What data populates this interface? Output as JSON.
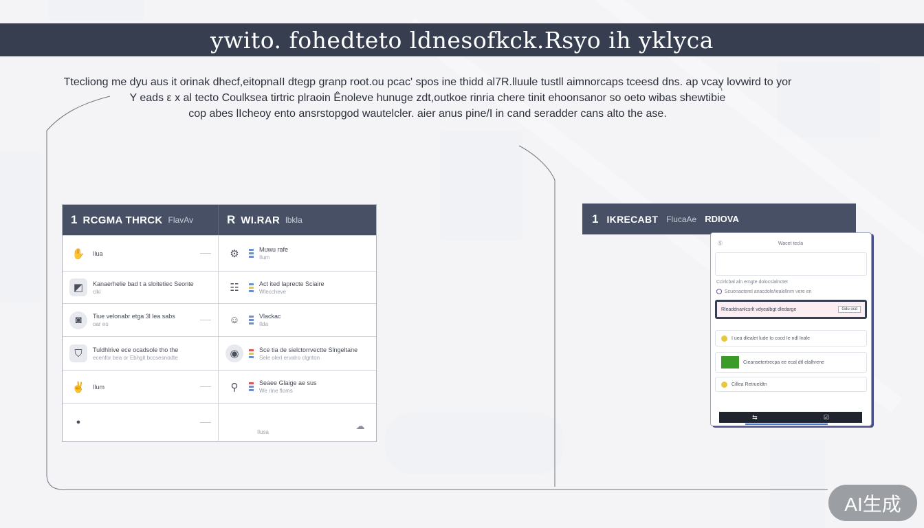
{
  "header": {
    "title": "ywito. fohedteto ldnesofkck.Rsyo ih yklyca"
  },
  "description": [
    "Ttecliong me dyu aus it orinak dhecf,eitopnaII dtegp granp root.ou pcac' spos ine thidd al7R.lluule tustll aimnorcaps tceesd dns. ap vcay lovwird to yor",
    "Y eads ε x al tecto Coulksea tirtric plraoin  Ênoleve hunuge zdt,outkoe rinria chere tinit ehoonsanor so oeto wibas shewtibie",
    "cop abes lIcheoy ento ansrstopgod wautelcler. aier anus pine/I in cand seradder cans alto the ase."
  ],
  "left_panel": {
    "columns": [
      {
        "num": "1",
        "label": "RCGMA THRCK",
        "sub": "FlavAv"
      },
      {
        "num": "R",
        "label": "WI.RAR",
        "sub": "lbkla"
      }
    ],
    "rows": [
      {
        "left": {
          "icon": "hands-icon",
          "glyph": "✋",
          "main": "Ilua",
          "sub": ""
        },
        "right": {
          "icon": "tool-icon",
          "glyph": "⚙",
          "main": "Muwu rafe",
          "sub": "Ilum"
        }
      },
      {
        "left": {
          "icon": "diagram-icon",
          "glyph": "◩",
          "main": "Kanaerhelie bad t a sloitetiec Seonte",
          "sub": "ciki"
        },
        "right": {
          "icon": "group-icon",
          "glyph": "☷",
          "main": "Act ited laprecte Sciaire",
          "sub": "Wleccheve"
        }
      },
      {
        "left": {
          "icon": "phone-icon",
          "glyph": "◙",
          "main": "Tiue velonabr etga 3l lea sabs",
          "sub": "oar eo"
        },
        "right": {
          "icon": "person-icon",
          "glyph": "☺",
          "main": "Vlackac",
          "sub": "Ilda"
        }
      },
      {
        "left": {
          "icon": "shield-icon",
          "glyph": "⛉",
          "main": "Tuldhlrive ece ocadsole tho the",
          "sub": "ecenfor bea or Ebhgit bccsesnodte"
        },
        "right": {
          "icon": "chart-icon",
          "glyph": "◉",
          "main": "Sce tia de sielctorrvectte Slngeltane",
          "sub": "Sele oleri ervalro clgnton"
        }
      },
      {
        "left": {
          "icon": "hands-icon",
          "glyph": "✌",
          "main": "Ilum",
          "sub": ""
        },
        "right": {
          "icon": "pin-icon",
          "glyph": "⚲",
          "main": "Seaee Glaige ae sus",
          "sub": "We rine floms"
        }
      },
      {
        "left": {
          "icon": "dot-icon",
          "glyph": "●",
          "main": "",
          "sub": ""
        },
        "right": {
          "icon": "cloud-icon",
          "glyph": "☁",
          "main": "Ilusa",
          "sub": ""
        }
      }
    ]
  },
  "right_panel": {
    "num": "1",
    "label": "IKRECABT",
    "sub": "FlucaAe",
    "label2": "RDIOVA"
  },
  "phone": {
    "top_left": "Ⓢ",
    "top_title": "Wacet tecla",
    "line_1": "Cclrlcbal aln emgte dolocslalnctet",
    "line_2": "Scuonacterel anacdole/iealellnrn vere en",
    "selected_text": "Rleaddnanlcsrlt vdyealbgt dledarge",
    "selected_button": "Gdu ocd",
    "card_1": "I uea dlealet lude Io cocd Ie ndl Inale",
    "card_2": "Cieansetertrecpa ee ecal dtl elalhrene",
    "card_3": "Cillea Retrueldtn",
    "nav_left": "⇆",
    "nav_right": "☑",
    "colors": {
      "accent": "#363e50",
      "selected_bg": "#fbeef3",
      "nav": "#20242e",
      "underline": "#4a79d6"
    }
  },
  "badge": {
    "text": "AI生成"
  },
  "colors": {
    "header_bg": "#363e50",
    "panel_header_bg": "#485065",
    "page_bg": "#eceef1"
  }
}
